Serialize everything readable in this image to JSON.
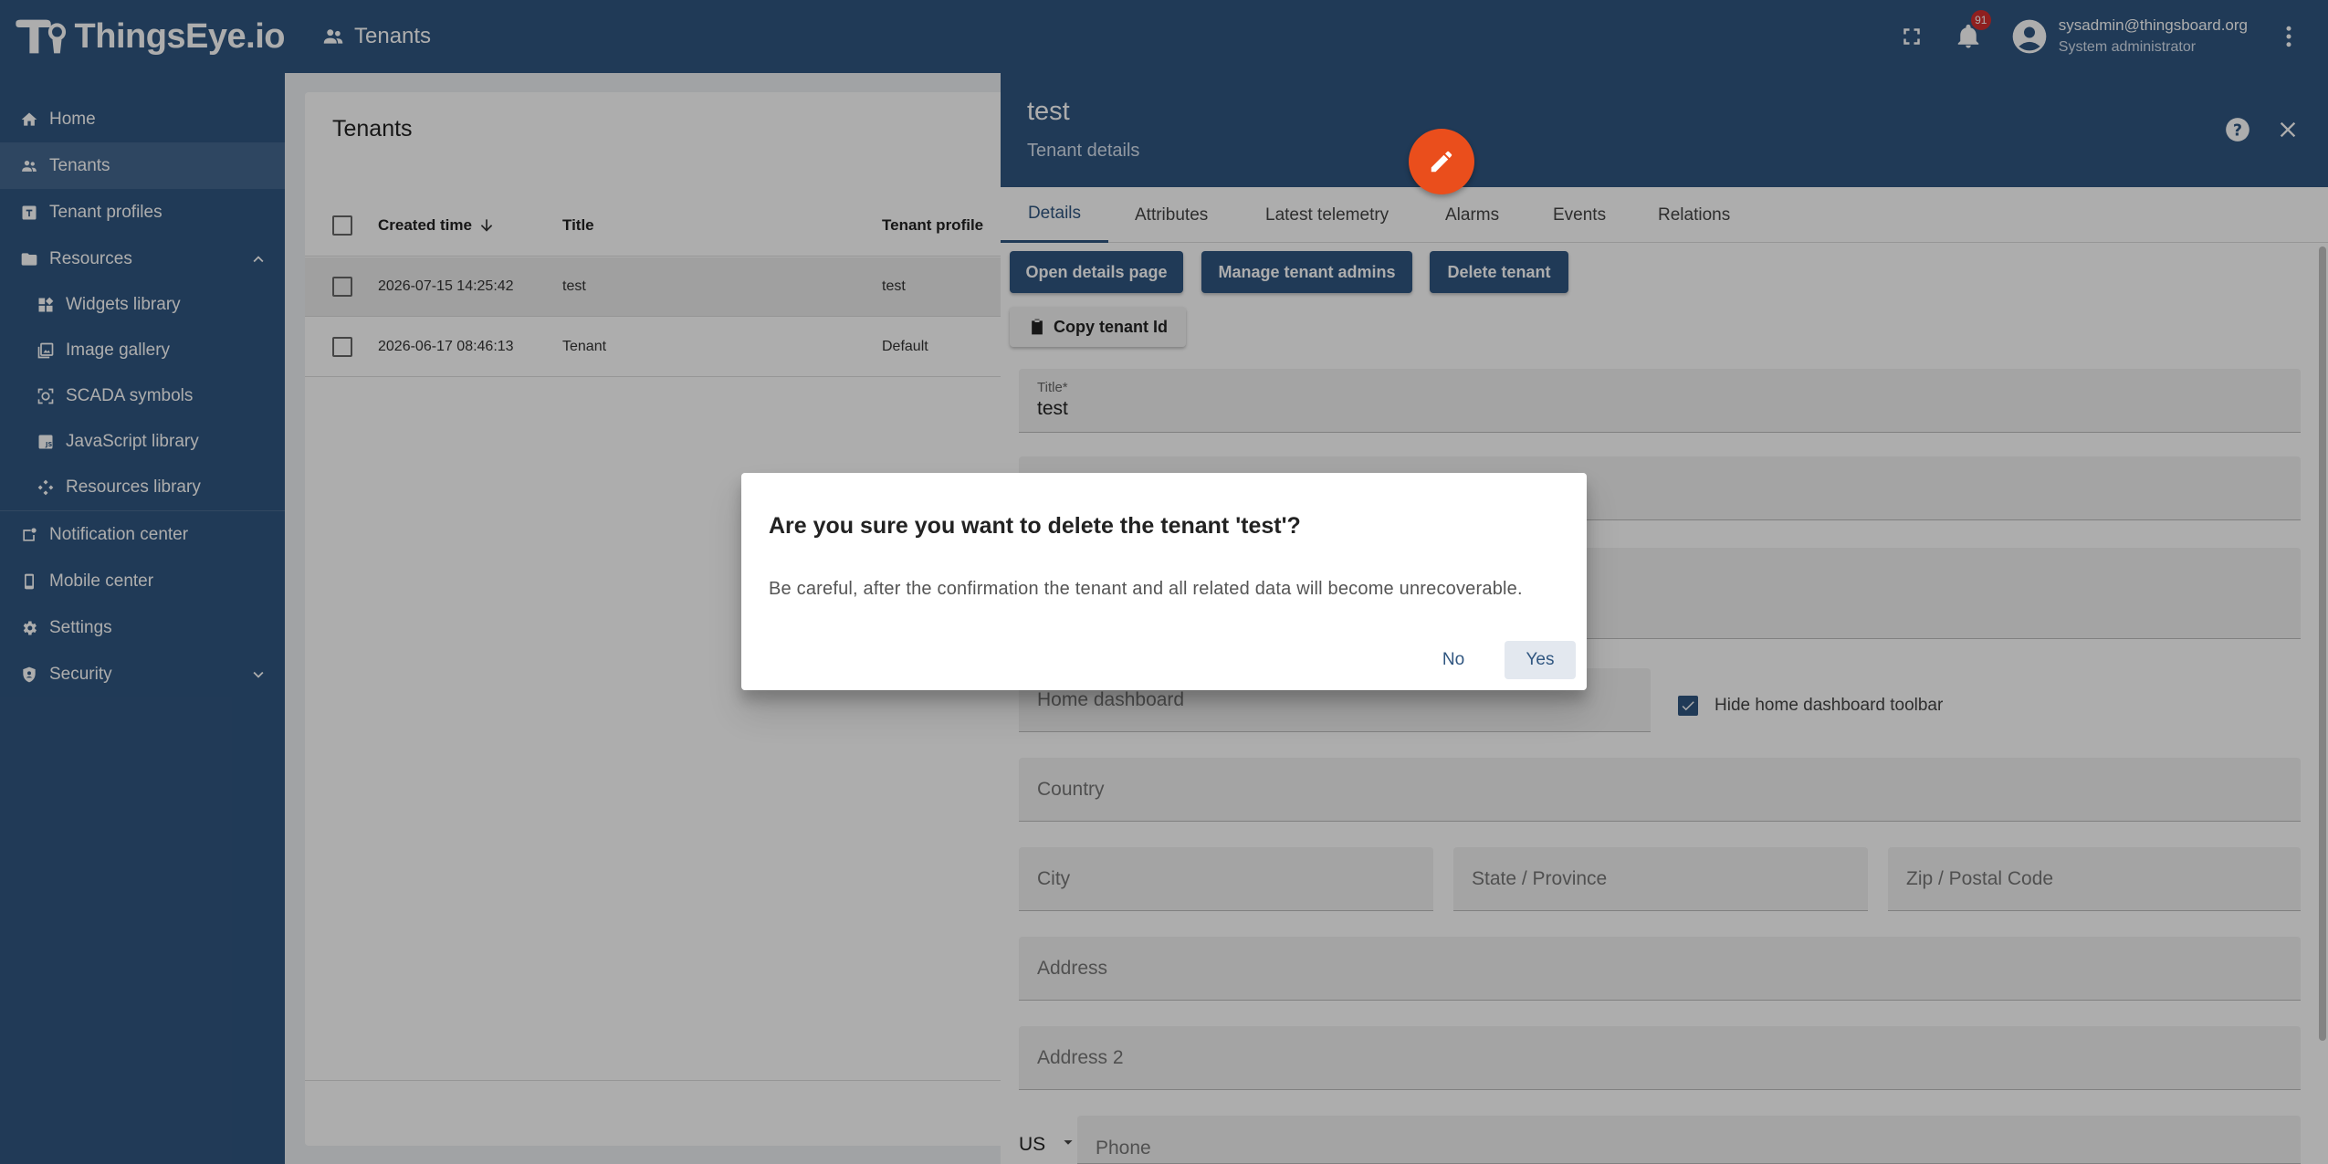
{
  "app": {
    "brand": "ThingsEye.io",
    "breadcrumb": "Tenants",
    "notifications_count": "91",
    "user_email": "sysadmin@thingsboard.org",
    "user_role": "System administrator"
  },
  "sidebar": {
    "items": [
      {
        "label": "Home",
        "icon": "home-icon"
      },
      {
        "label": "Tenants",
        "icon": "tenants-icon",
        "active": true
      },
      {
        "label": "Tenant profiles",
        "icon": "tenant-profiles-icon"
      },
      {
        "label": "Resources",
        "icon": "folder-icon",
        "expanded": true
      },
      {
        "label": "Widgets library",
        "icon": "widgets-icon"
      },
      {
        "label": "Image gallery",
        "icon": "image-icon"
      },
      {
        "label": "SCADA symbols",
        "icon": "scada-icon"
      },
      {
        "label": "JavaScript library",
        "icon": "javascript-icon"
      },
      {
        "label": "Resources library",
        "icon": "resources-icon"
      },
      {
        "label": "Notification center",
        "icon": "notification-icon"
      },
      {
        "label": "Mobile center",
        "icon": "mobile-icon"
      },
      {
        "label": "Settings",
        "icon": "gear-icon"
      },
      {
        "label": "Security",
        "icon": "shield-icon"
      }
    ]
  },
  "table": {
    "title": "Tenants",
    "columns": [
      "Created time",
      "Title",
      "Tenant profile"
    ],
    "rows": [
      {
        "created": "2026-07-15 14:25:42",
        "title": "test",
        "profile": "test"
      },
      {
        "created": "2026-06-17 08:46:13",
        "title": "Tenant",
        "profile": "Default"
      }
    ]
  },
  "details": {
    "title": "test",
    "subtitle": "Tenant details",
    "tabs": [
      "Details",
      "Attributes",
      "Latest telemetry",
      "Alarms",
      "Events",
      "Relations"
    ],
    "buttons": {
      "open_details": "Open details page",
      "manage_admins": "Manage tenant admins",
      "delete": "Delete tenant",
      "copy_id": "Copy tenant Id"
    },
    "fields": {
      "title_label": "Title*",
      "title_value": "test",
      "home_dashboard": "Home dashboard",
      "hide_toolbar": "Hide home dashboard toolbar",
      "country": "Country",
      "city": "City",
      "state": "State / Province",
      "zip": "Zip / Postal Code",
      "address": "Address",
      "address2": "Address 2",
      "phone_country": "US",
      "phone": "Phone"
    }
  },
  "dialog": {
    "title": "Are you sure you want to delete the tenant 'test'?",
    "body": "Be careful, after the confirmation the tenant and all related data will become unrecoverable.",
    "no": "No",
    "yes": "Yes"
  },
  "colors": {
    "primary": "#305680",
    "accent": "#ea4e1c",
    "badge": "#d32f2f"
  }
}
